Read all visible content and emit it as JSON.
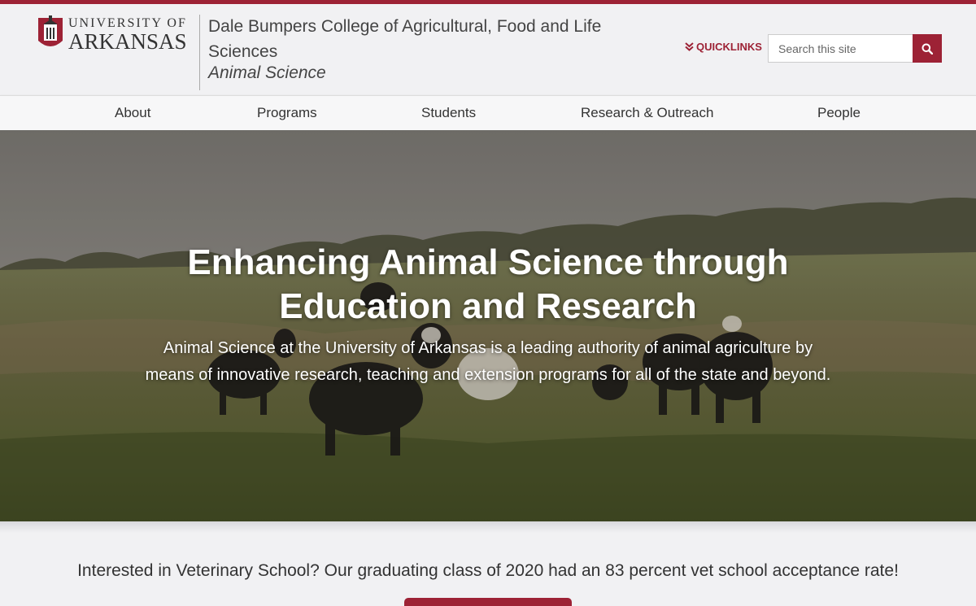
{
  "brand": {
    "logo_line1": "UNIVERSITY OF",
    "logo_line2": "ARKANSAS",
    "accent_color": "#9d2235"
  },
  "header": {
    "college": "Dale Bumpers College of Agricultural, Food and Life Sciences",
    "department": "Animal Science",
    "quicklinks_label": "QUICKLINKS",
    "quicklinks_icon": "double-chevron-down-icon",
    "search_placeholder": "Search this site",
    "search_icon": "search-icon"
  },
  "nav": {
    "items": [
      "About",
      "Programs",
      "Students",
      "Research & Outreach",
      "People"
    ]
  },
  "hero": {
    "title_line1": "Enhancing Animal Science through",
    "title_line2": "Education and Research",
    "description": "Animal Science at the University of Arkansas is a leading authority of animal agriculture by means of innovative research, teaching and extension programs for all of the state and beyond."
  },
  "callout": {
    "text": "Interested in Veterinary School? Our graduating class of 2020 had an 83 percent vet school acceptance rate!"
  }
}
